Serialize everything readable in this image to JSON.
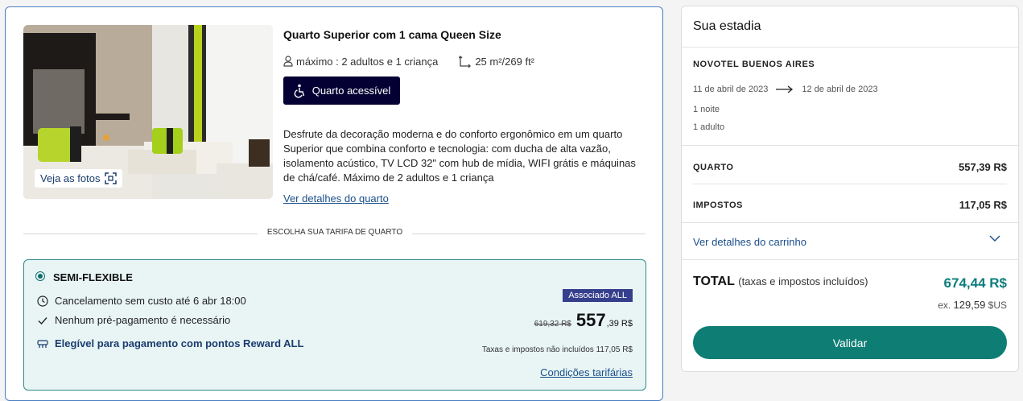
{
  "room": {
    "title": "Quarto Superior com 1 cama Queen Size",
    "capacity": "máximo : 2 adultos e 1 criança",
    "size": "25 m²/269 ft²",
    "accessible_label": "Quarto acessível",
    "photos_label": "Veja as fotos",
    "description": "Desfrute da decoração moderna e do conforto ergonômico em um quarto Superior que combina conforto e tecnologia: com ducha de alta vazão, isolamento acústico, TV LCD 32\" com hub de mídia, WIFI grátis e máquinas de chá/café. Máximo de 2 adultos e 1 criança",
    "details_link": "Ver detalhes do quarto"
  },
  "rate_section_label": "ESCOLHA SUA TARIFA DE QUARTO",
  "rate": {
    "name": "SEMI-FLEXIBLE",
    "cancellation": "Cancelamento sem custo até 6 abr 18:00",
    "prepayment": "Nenhum pré-pagamento é necessário",
    "reward": "Elegível para pagamento com pontos Reward ALL",
    "member_badge": "Associado ALL",
    "old_price": "619,32 R$",
    "price_int": "557",
    "price_dec": ",39 R$",
    "taxes_note": "Taxas e impostos não incluídos 117,05 R$",
    "conditions_link": "Condições tarifárias"
  },
  "summary": {
    "title": "Sua estadia",
    "hotel": "NOVOTEL BUENOS AIRES",
    "checkin": "11 de abril de 2023",
    "checkout": "12 de abril de 2023",
    "nights": "1 noite",
    "guests": "1 adulto",
    "room_label": "QUARTO",
    "room_value": "557,39 R$",
    "tax_label": "IMPOSTOS",
    "tax_value": "117,05 R$",
    "cart_link": "Ver detalhes do carrinho",
    "total_label": "TOTAL",
    "total_sub": "(taxas e impostos incluídos)",
    "total_value": "674,44 R$",
    "usd_prefix": "ex.",
    "usd_value": "129,59",
    "usd_unit": "$US",
    "validate_label": "Validar"
  },
  "colors": {
    "accent_teal": "#0e7d74",
    "navy_button": "#050033",
    "member_badge": "#353f8c",
    "link": "#1a4f8a"
  }
}
